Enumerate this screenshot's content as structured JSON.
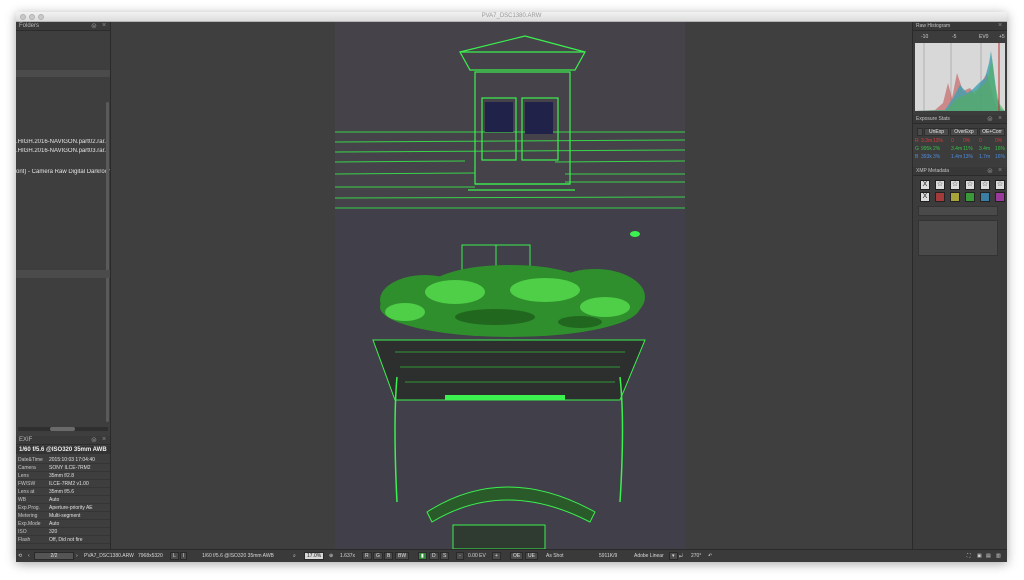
{
  "window": {
    "title": "PVA7_DSC1380.ARW"
  },
  "folders_panel": {
    "title": "Folders",
    "lines": [
      ".HIGH.2016-NAVIGON.part02.rar.d",
      ".HIGH.2016-NAVIGON.part03.rar.d",
      "ont) - Camera Raw Digital Darkroom"
    ]
  },
  "exif_panel": {
    "title": "EXIF",
    "summary": "1/60 f/5.6 @ISO320 35mm AWB",
    "rows": [
      {
        "key": "Date&Time",
        "value": "2015:10:03 17:04:40"
      },
      {
        "key": "Camera",
        "value": "SONY ILCE-7RM2"
      },
      {
        "key": "Lens",
        "value": "35mm f/2.8"
      },
      {
        "key": "FW/SW",
        "value": "ILCE-7RM2 v1.00"
      },
      {
        "key": "Lens at",
        "value": "35mm f/5.6"
      },
      {
        "key": "WB",
        "value": "Auto"
      },
      {
        "key": "Exp.Prog.",
        "value": "Aperture-priority AE"
      },
      {
        "key": "Metering",
        "value": "Multi-segment"
      },
      {
        "key": "Exp.Mode",
        "value": "Auto"
      },
      {
        "key": "ISO",
        "value": "320"
      },
      {
        "key": "Flash",
        "value": "Off, Did not fire"
      }
    ]
  },
  "histogram_panel": {
    "title": "Raw Histogram",
    "labels": [
      "-10",
      "-5",
      "EV0",
      "+5"
    ]
  },
  "exposure_panel": {
    "title": "Exposure Stats",
    "buttons": [
      "UnExp",
      "OverExp",
      "OE+Corr"
    ],
    "rows": [
      {
        "ch": "R",
        "a": "3.3m",
        "b": "13%",
        "c": "0",
        "d": "0%",
        "e": "0",
        "f": "0%",
        "color": "#e03a3a"
      },
      {
        "ch": "G",
        "a": "995k",
        "b": "2%",
        "c": "3.4m",
        "d": "11%",
        "e": "3.4m",
        "f": "16%",
        "color": "#39c24a"
      },
      {
        "ch": "B",
        "a": "393k",
        "b": "3%",
        "c": "1.4m",
        "d": "13%",
        "e": "1.7m",
        "f": "16%",
        "color": "#4f8ee0"
      }
    ]
  },
  "xmp_panel": {
    "title": "XMP Metadata",
    "star_glyph": "☆",
    "reject_glyph": "X",
    "swatch_colors": [
      "#a33b3b",
      "#a8a43a",
      "#3a9a3a",
      "#3a7fa3",
      "#9a3a9a"
    ]
  },
  "statusbar": {
    "page": "2/2",
    "filename": "PVA7_DSC1380.ARW",
    "dimensions": "7968x5320",
    "btn_l": "L",
    "btn_i": "I",
    "exposure_info": "1/60 f/5.6 @ISO320 35mm AWB",
    "zoom": "17.0%",
    "ratio": "1.637x",
    "channels": [
      "R",
      "G",
      "B",
      "BW"
    ],
    "modes": [
      "D",
      "S"
    ],
    "ev": "0.00 EV",
    "ev_minus": "-",
    "ev_plus": "+",
    "oe": "OE",
    "ue": "UE",
    "wb": "As Shot",
    "temp": "5911K/9",
    "curve": "Adobe Linear",
    "rotation": "270°"
  }
}
